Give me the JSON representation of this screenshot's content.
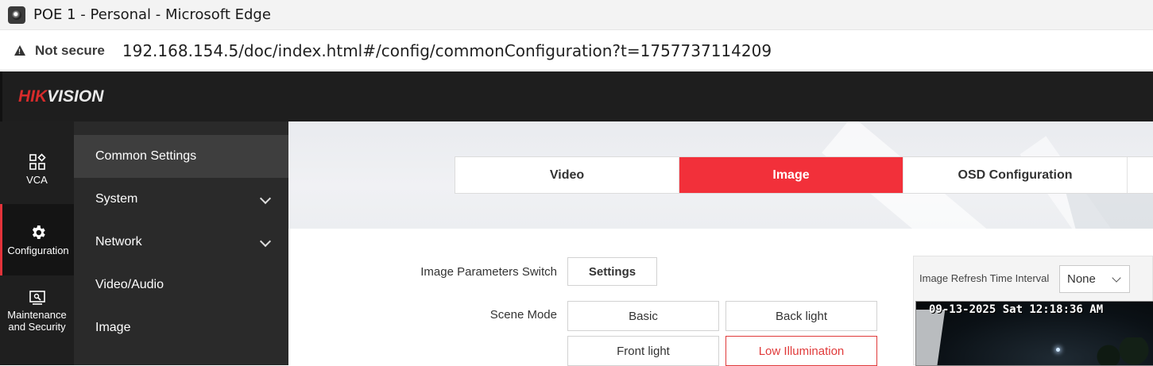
{
  "window": {
    "title": "POE 1 - Personal - Microsoft Edge"
  },
  "address_bar": {
    "security_label": "Not secure",
    "url": "192.168.154.5/doc/index.html#/config/commonConfiguration?t=1757737114209"
  },
  "brand": {
    "logo_red": "HIK",
    "logo_white": "VISION",
    "accent_color": "#f2303a"
  },
  "icon_nav": [
    {
      "label": "VCA",
      "icon": "vca-icon"
    },
    {
      "label": "Configuration",
      "icon": "gear-icon"
    },
    {
      "label": "Maintenance and Security",
      "label_line1": "Maintenance",
      "label_line2": "and Security",
      "icon": "maintenance-icon"
    }
  ],
  "menu": [
    {
      "label": "Common Settings",
      "active": true,
      "expandable": false
    },
    {
      "label": "System",
      "expandable": true
    },
    {
      "label": "Network",
      "expandable": true
    },
    {
      "label": "Video/Audio",
      "expandable": false
    },
    {
      "label": "Image",
      "expandable": false
    }
  ],
  "tabs": [
    {
      "label": "Video"
    },
    {
      "label": "Image",
      "active": true
    },
    {
      "label": "OSD Configuration"
    }
  ],
  "form": {
    "image_params_label": "Image Parameters Switch",
    "settings_button": "Settings",
    "scene_mode_label": "Scene Mode",
    "scene_modes": [
      "Basic",
      "Back light",
      "Front light",
      "Low Illumination"
    ],
    "selected_scene_mode": "Low Illumination"
  },
  "preview": {
    "refresh_label": "Image Refresh Time Interval",
    "refresh_value": "None",
    "osd_text": "09-13-2025 Sat 12:18:36 AM"
  }
}
